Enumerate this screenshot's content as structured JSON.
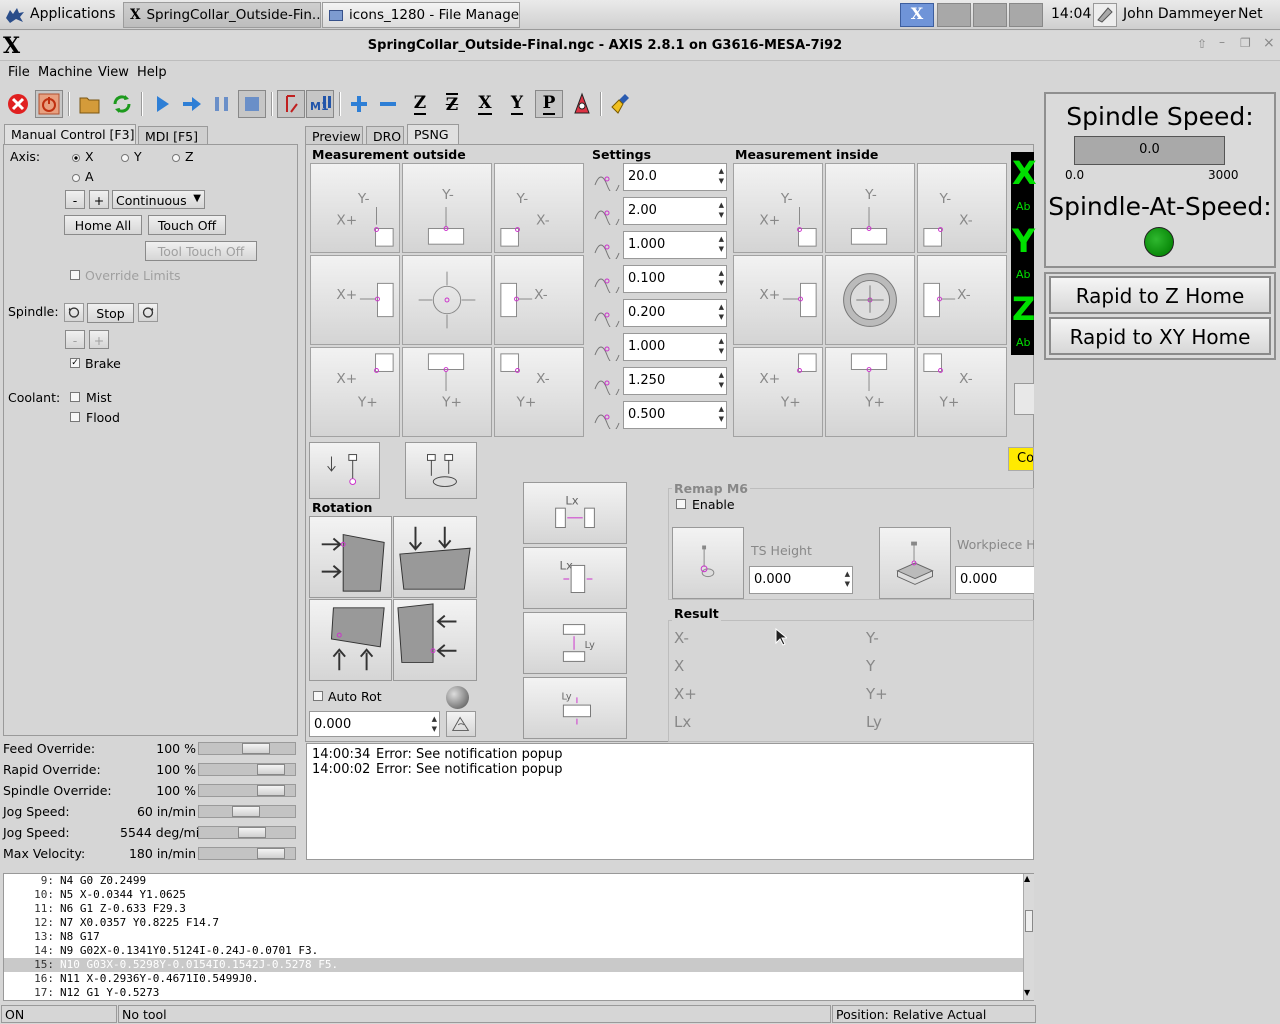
{
  "taskbar": {
    "applications_label": "Applications",
    "windows": [
      "SpringCollar_Outside-Fin...",
      "icons_1280 - File Manager"
    ],
    "clock": "14:04",
    "user": "John Dammeyer",
    "net": "Net"
  },
  "window": {
    "title": "SpringCollar_Outside-Final.ngc - AXIS 2.8.1 on G3616-MESA-7i92"
  },
  "menu": [
    "File",
    "Machine",
    "View",
    "Help"
  ],
  "left_tabs": [
    "Manual Control [F3]",
    "MDI [F5]"
  ],
  "manual": {
    "axis_label": "Axis:",
    "axes": [
      "X",
      "Y",
      "Z",
      "A"
    ],
    "selected_axis": "X",
    "minus": "-",
    "plus": "+",
    "jog_mode": "Continuous",
    "home_all": "Home All",
    "touch_off": "Touch Off",
    "tool_touch_off": "Tool Touch Off",
    "override_limits": "Override Limits",
    "spindle_label": "Spindle:",
    "stop": "Stop",
    "brake": "Brake",
    "brake_checked": true,
    "coolant_label": "Coolant:",
    "mist": "Mist",
    "flood": "Flood"
  },
  "overrides": [
    {
      "label": "Feed Override:",
      "value": "100 %",
      "level": 0.63
    },
    {
      "label": "Rapid Override:",
      "value": "100 %",
      "level": 0.85
    },
    {
      "label": "Spindle Override:",
      "value": "100 %",
      "level": 0.85
    },
    {
      "label": "Jog Speed:",
      "value": "60 in/min",
      "level": 0.49
    },
    {
      "label": "Jog Speed:",
      "value": "5544 deg/min",
      "level": 0.57
    },
    {
      "label": "Max Velocity:",
      "value": "180 in/min",
      "level": 0.85
    }
  ],
  "main_tabs": [
    "Preview",
    "DRO",
    "PSNG"
  ],
  "psng": {
    "measurement_outside": "Measurement outside",
    "settings": "Settings",
    "measurement_inside": "Measurement inside",
    "settings_values": [
      "20.0",
      "2.00",
      "1.000",
      "0.100",
      "0.200",
      "1.000",
      "1.250",
      "0.500"
    ],
    "rotation": "Rotation",
    "auto_rot": "Auto Rot",
    "rotation_value": "0.000",
    "remap_title": "Remap M6",
    "enable": "Enable",
    "ts_height_label": "TS Height",
    "ts_height_value": "0.000",
    "workpiece_label": "Workpiece H",
    "workpiece_value": "0.000",
    "result_title": "Result",
    "result_left": [
      "X-",
      "X",
      "X+",
      "Lx"
    ],
    "result_right": [
      "Y-",
      "Y",
      "Y+",
      "Ly"
    ],
    "lx": "Lx",
    "ly": "Ly",
    "dro_letters": [
      "X",
      "Y",
      "Z"
    ],
    "dro_sub": "Ab",
    "co_button": "Co"
  },
  "messages": [
    {
      "time": "14:00:34",
      "text": "Error: See notification popup"
    },
    {
      "time": "14:00:02",
      "text": "Error: See notification popup"
    }
  ],
  "gcode": [
    {
      "n": "9:",
      "code": "N4 G0 Z0.2499"
    },
    {
      "n": "10:",
      "code": "N5 X-0.0344 Y1.0625"
    },
    {
      "n": "11:",
      "code": "N6 G1 Z-0.633 F29.3"
    },
    {
      "n": "12:",
      "code": "N7 X0.0357 Y0.8225 F14.7"
    },
    {
      "n": "13:",
      "code": "N8 G17"
    },
    {
      "n": "14:",
      "code": "N9 G02X-0.1341Y0.5124I-0.24J-0.0701 F3."
    },
    {
      "n": "15:",
      "code": "N10 G03X-0.5298Y-0.0154I0.1542J-0.5278 F5."
    },
    {
      "n": "16:",
      "code": "N11 X-0.2936Y-0.4671I0.5499J0."
    },
    {
      "n": "17:",
      "code": "N12 G1 Y-0.5273"
    }
  ],
  "gcode_selected_index": 6,
  "statusbar": {
    "state": "ON",
    "tool": "No tool",
    "position": "Position: Relative Actual"
  },
  "spindle_panel": {
    "speed_title": "Spindle Speed:",
    "speed_value": "0.0",
    "scale_min": "0.0",
    "scale_max": "3000",
    "at_speed_title": "Spindle-At-Speed:",
    "led_color": "#0a8a0a",
    "rapid_z": "Rapid to Z Home",
    "rapid_xy": "Rapid to XY Home"
  },
  "colors": {
    "dro_bg": "#000000",
    "dro_fg": "#00e000",
    "warning_yellow": "#ffea00",
    "probe_magenta": "#cc33cc",
    "abort_red": "#e02020"
  }
}
